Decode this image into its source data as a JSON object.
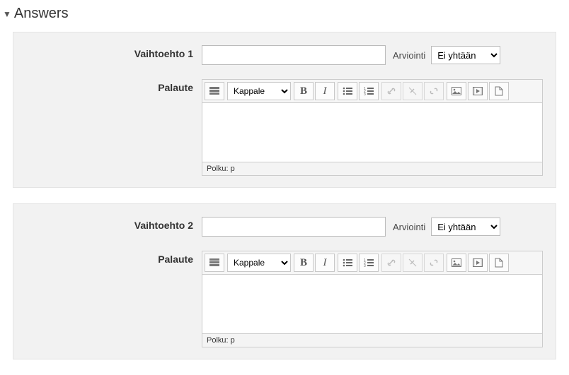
{
  "section": {
    "title": "Answers"
  },
  "answers": [
    {
      "option_label": "Vaihtoehto 1",
      "option_value": "",
      "grade_label": "Arviointi",
      "grade_value": "Ei yhtään",
      "feedback_label": "Palaute",
      "feedback_html": "",
      "para_format": "Kappale",
      "status_path": "Polku: p"
    },
    {
      "option_label": "Vaihtoehto 2",
      "option_value": "",
      "grade_label": "Arviointi",
      "grade_value": "Ei yhtään",
      "feedback_label": "Palaute",
      "feedback_html": "",
      "para_format": "Kappale",
      "status_path": "Polku: p"
    }
  ]
}
